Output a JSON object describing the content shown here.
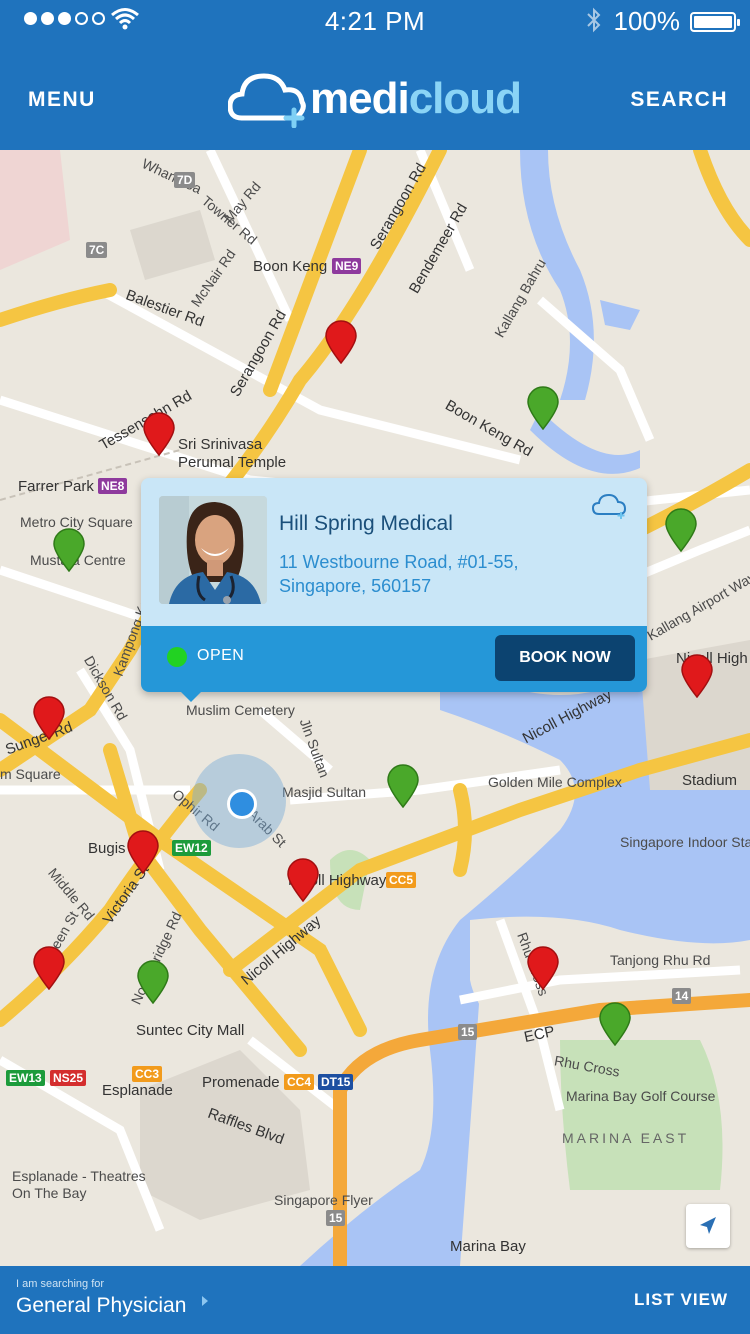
{
  "status_bar": {
    "time": "4:21 PM",
    "battery": "100%"
  },
  "header": {
    "menu_label": "MENU",
    "logo_text": "medicloud",
    "search_label": "SEARCH"
  },
  "map": {
    "labels": [
      "Whampoa",
      "Towner Rd",
      "May Rd",
      "McNair Rd",
      "Boon Keng",
      "Balestier Rd",
      "Serangoon Rd",
      "Bendemeer Rd",
      "Kallang Bahru",
      "Boon Keng Rd",
      "Tessensohn Rd",
      "Sri Srinivasa",
      "Perumal Temple",
      "Farrer Park",
      "Metro City Square",
      "Mustafa Centre",
      "Kampong Kapor",
      "Dickson Rd",
      "Sungei Rd",
      "Muslim Cemetery",
      "Jln Sultan",
      "Golden Mile Complex",
      "Masjid Sultan",
      "Ophir Rd",
      "Arab St",
      "Nicoll Highway",
      "Bugis",
      "Victoria St",
      "North Bridge Rd",
      "Middle Rd",
      "Queen St",
      "Singapore Indoor Stadium",
      "Stadium",
      "Tanjong Rhu Rd",
      "Rhu Cross",
      "ECP",
      "Suntec City Mall",
      "Esplanade",
      "Promenade",
      "Raffles Blvd",
      "Marina Bay Golf Course",
      "MARINA EAST",
      "Esplanade - Theatres On The Bay",
      "Singapore Flyer",
      "Marina Bay",
      "m Square",
      "Kallang Airport Way",
      "Nicoll High"
    ],
    "badges": [
      "7D",
      "7C",
      "NE9",
      "NE8",
      "CC5",
      "EW12",
      "CC3",
      "CC4",
      "DT15",
      "EW13",
      "NS25",
      "15",
      "14",
      "15"
    ],
    "red_pins": 9,
    "green_pins": 6
  },
  "clinic_card": {
    "name": "Hill Spring Medical",
    "address_line1": "11 Westbourne Road, #01-55,",
    "address_line2": "Singapore, 560157",
    "status": "OPEN",
    "book_label": "BOOK NOW"
  },
  "bottom_bar": {
    "hint": "I am searching for",
    "value": "General Physician",
    "list_view_label": "LIST VIEW"
  },
  "colors": {
    "brand_blue": "#1f73bd",
    "card_bg": "#c9e6f7",
    "card_action_bg": "#2597d8",
    "button_dark": "#0c4370",
    "open_green": "#22d222",
    "pin_red": "#e0191b",
    "pin_green": "#4aa82a"
  }
}
